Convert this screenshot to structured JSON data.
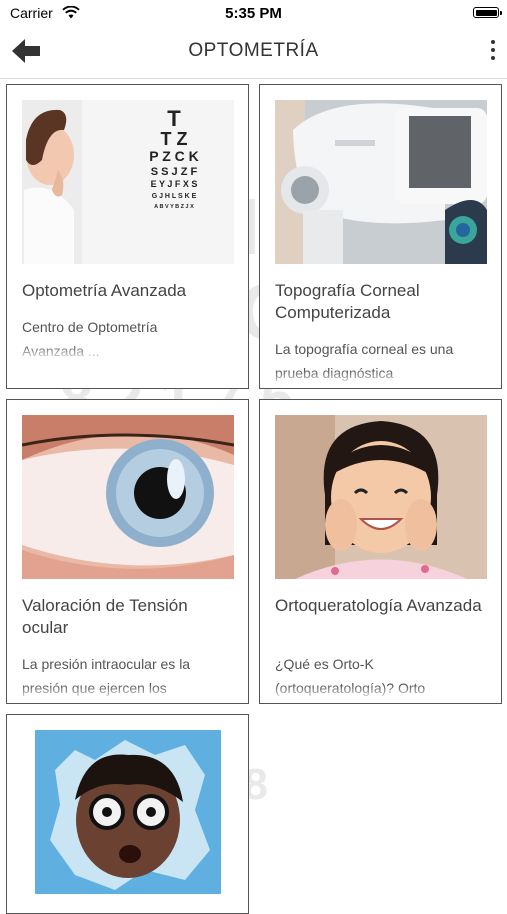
{
  "status_bar": {
    "carrier": "Carrier",
    "time": "5:35 PM"
  },
  "header": {
    "title": "OPTOMETRÍA"
  },
  "cards": [
    {
      "title": "Optometría Avanzada",
      "description": "Centro de Optometría Avanzada ...",
      "image": "eye-chart"
    },
    {
      "title": "Topografía Corneal Computerizada",
      "description": "La topografía corneal es una prueba diagnóstica",
      "image": "topographer"
    },
    {
      "title": "Valoración de Tensión ocular",
      "description": "La presión intraocular es la presión que ejercen los",
      "image": "eye-closeup"
    },
    {
      "title": "Ortoqueratología Avanzada",
      "description": "¿Qué es Orto-K (ortoqueratología)? Orto",
      "image": "smiling-girl"
    },
    {
      "title": "",
      "description": "",
      "image": "child-glasses"
    }
  ],
  "eye_chart": {
    "rows": [
      "T",
      "T Z",
      "P Z C K",
      "S S J Z F",
      "E Y J F X S",
      "G J H L S K E",
      "A B V Y B Z J X"
    ]
  },
  "colors": {
    "card_border": "#555555",
    "title_text": "#444444",
    "header_text": "#333333"
  }
}
